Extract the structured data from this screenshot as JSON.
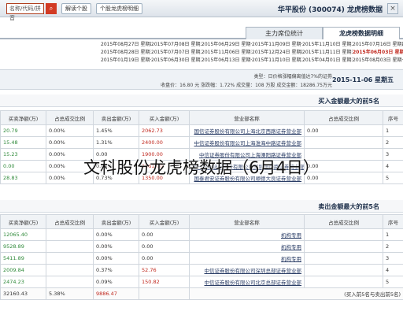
{
  "titlebar": {
    "stock_title": "华平股份 (300074) 龙虎榜数据",
    "button1": "个股龙虎榜明细",
    "button2": "解读个股",
    "button3": "名称/代码/拼音",
    "search_value": "名称/代码/拼音"
  },
  "tabs": [
    {
      "label": "龙虎榜数据明细"
    },
    {
      "label": "主力席位统计"
    }
  ],
  "date_rows": [
    [
      "2015年08月27日 星期四",
      "2015年07月08日 星期三",
      "2015年06月29日 星期一",
      "2015年11月09日 星期一",
      "2015年11月10日 星期二",
      "2015年07月16日 星期四"
    ],
    [
      "2015年08月28日 星期五",
      "2015年07月07日 星期二",
      "2015年11月06日 星期五",
      "2015年12月24日 星期四",
      "2015年11月11日 星期三",
      "2015年06月03日 星期三"
    ],
    [
      "2015年01月19日 星期一",
      "2015年06月30日 星期二",
      "2015年06月13日 星期一",
      "2015年11月10日 星期二",
      "2015年04月01日 星期三",
      "2015年08月03日 星期一"
    ]
  ],
  "info": {
    "date": "2015-11-06 星期五",
    "line1": "类型：日价格涨幅偏离值达7%的证券",
    "line2": "收盘价：16.80 元    涨跌幅：1.72%    成交量：108 万股    成交金额：18286.75万元"
  },
  "buy_section": {
    "title": "买入金额最大的前5名",
    "headers": [
      "序号",
      "营业部名称",
      "买入金额(万)",
      "占总成交比例",
      "卖出金额(万)",
      "占总成交比例",
      "买卖净额(万)"
    ],
    "rows": [
      {
        "seq": "1",
        "seat": "国信证券股份有限公司上海北京西路证券营业部",
        "buy": "2062.73",
        "buy_pct": "1.45%",
        "sell": "0.00",
        "sell_pct": "0.00%",
        "net": "20.79"
      },
      {
        "seq": "2",
        "seat": "中信证券股份有限公司上海淮海中路证券营业部",
        "buy": "2400.00",
        "buy_pct": "1.31%",
        "sell": "",
        "sell_pct": "0.00%",
        "net": "15.48"
      },
      {
        "seq": "3",
        "seat": "中信证券股份有限公司上海溧阳路证券营业部",
        "buy": "1900.00",
        "buy_pct": "",
        "sell": "0.00",
        "sell_pct": "0.00%",
        "net": "15.23"
      },
      {
        "seq": "4",
        "seat": "第一创业证券股份有限公司深圳笋岗路证券营业部",
        "buy": "1561.00",
        "buy_pct": "0.85%",
        "sell": "0.00",
        "sell_pct": "0.00%",
        "net": "0.00"
      },
      {
        "seq": "5",
        "seat": "国泰君安证券股份有限公司顺德大良证券营业部",
        "buy": "1350.00",
        "buy_pct": "0.73%",
        "sell": "0.00",
        "sell_pct": "0.00%",
        "net": "28.83"
      }
    ]
  },
  "sell_section": {
    "title": "卖出金额最大的前5名",
    "headers": [
      "序号",
      "营业部名称",
      "买入金额(万)",
      "占总成交比例",
      "卖出金额(万)",
      "占总成交比例",
      "买卖净额(万)"
    ],
    "rows": [
      {
        "seq": "1",
        "seat": "机构专用",
        "buy": "0.00",
        "buy_pct": "0.00%",
        "sell": "",
        "sell_pct": "",
        "net": "12065.40"
      },
      {
        "seq": "2",
        "seat": "机构专用",
        "buy": "0.00",
        "buy_pct": "0.00%",
        "sell": "",
        "sell_pct": "",
        "net": "9528.89"
      },
      {
        "seq": "3",
        "seat": "机构专用",
        "buy": "0.00",
        "buy_pct": "0.00%",
        "sell": "",
        "sell_pct": "",
        "net": "5411.89"
      },
      {
        "seq": "4",
        "seat": "中信证券股份有限公司深圳总部证券营业部",
        "buy": "52.76",
        "buy_pct": "0.37%",
        "sell": "",
        "sell_pct": "",
        "net": "2009.84"
      },
      {
        "seq": "5",
        "seat": "中信证券股份有限公司北京总部证券营业部",
        "buy": "150.82",
        "buy_pct": "0.09%",
        "sell": "",
        "sell_pct": "",
        "net": "2474.23"
      }
    ],
    "total": {
      "label": "(买入前5名与卖出前5名)",
      "buy": "9886.47",
      "buy_pct": "5.38%",
      "sell": "",
      "sell_pct": "",
      "net": "32160.43"
    }
  },
  "caption": "文科股份龙虎榜数据（6月4日）",
  "colors": {
    "accent_red": "#c0281e",
    "accent_green": "#2f8a3a",
    "header_bg": "#f0f3f6"
  }
}
